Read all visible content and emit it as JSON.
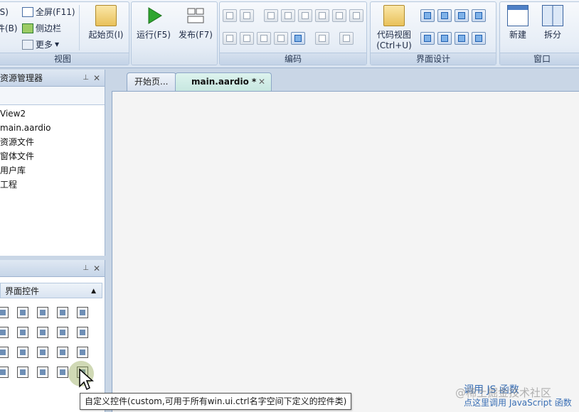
{
  "ribbon": {
    "view_group": {
      "caption": "视图",
      "items": [
        {
          "label": "(S)"
        },
        {
          "label": "件(B)"
        },
        {
          "label": "全屏(F11)"
        },
        {
          "label": "侧边栏"
        },
        {
          "label": "更多"
        }
      ],
      "start_page_label": "起始页(I)"
    },
    "run_group": {
      "run_label": "运行(F5)",
      "publish_label": "发布(F7)"
    },
    "edit_group": {
      "caption": "编码"
    },
    "ui_design_group": {
      "caption": "界面设计",
      "code_view_label": "代码视图",
      "code_view_shortcut": "(Ctrl+U)"
    },
    "window_group": {
      "caption": "窗口",
      "new_label": "新建",
      "split_label": "拆分"
    }
  },
  "resource_panel": {
    "title": "资源管理器",
    "items": [
      {
        "label": "View2"
      },
      {
        "label": "main.aardio"
      },
      {
        "label": "资源文件"
      },
      {
        "label": "窗体文件"
      },
      {
        "label": "用户库"
      },
      {
        "label": "工程"
      }
    ]
  },
  "controls_panel": {
    "section_label": "界面控件"
  },
  "editor_tabs": [
    {
      "label": "开始页..."
    },
    {
      "label": "main.aardio *"
    }
  ],
  "tooltip": {
    "text": "自定义控件(custom,可用于所有win.ui.ctrl名字空间下定义的控件类)"
  },
  "watermark": {
    "line1": "调用 JS 函数",
    "line2": "点这里调用 JavaScript 函数",
    "brand": "@稀土掘金技术社区"
  },
  "colors": {
    "accent": "#3a6fb5",
    "tab_active": "#cbe8e1",
    "ribbon": "#dde6f2"
  }
}
